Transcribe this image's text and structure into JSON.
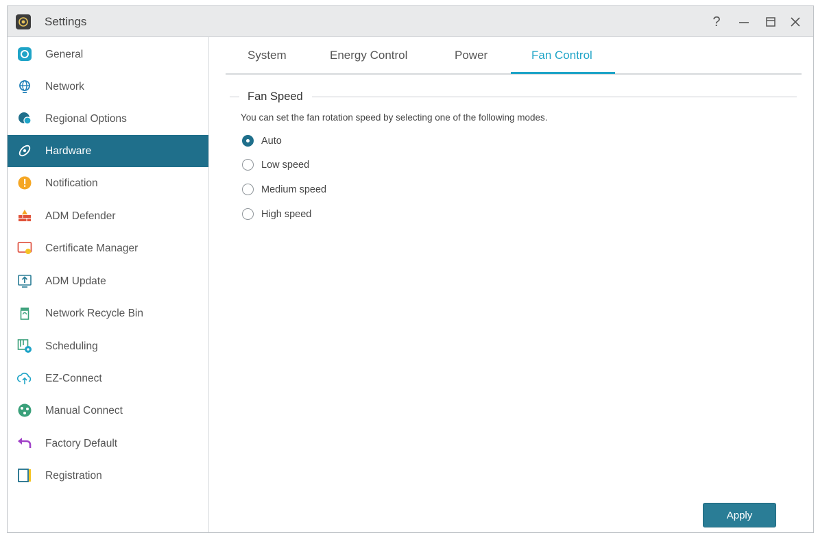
{
  "window": {
    "title": "Settings",
    "controls": [
      "help",
      "minimize",
      "maximize",
      "close"
    ]
  },
  "sidebar": {
    "selected": "Hardware",
    "items": [
      {
        "label": "General",
        "icon": "general-icon",
        "color": "#1fa4c7"
      },
      {
        "label": "Network",
        "icon": "globe-icon",
        "color": "#1f7fb8"
      },
      {
        "label": "Regional Options",
        "icon": "regional-icon",
        "color": "#1f6f8b"
      },
      {
        "label": "Hardware",
        "icon": "hardware-icon",
        "color": "#ffffff"
      },
      {
        "label": "Notification",
        "icon": "notification-icon",
        "color": "#f5a623"
      },
      {
        "label": "ADM Defender",
        "icon": "firewall-icon",
        "color": "#e0533a"
      },
      {
        "label": "Certificate Manager",
        "icon": "certificate-icon",
        "color": "#e05a4a"
      },
      {
        "label": "ADM Update",
        "icon": "update-icon",
        "color": "#2a7d96"
      },
      {
        "label": "Network Recycle Bin",
        "icon": "recycle-bin-icon",
        "color": "#3aa07a"
      },
      {
        "label": "Scheduling",
        "icon": "scheduling-icon",
        "color": "#3aa07a"
      },
      {
        "label": "EZ-Connect",
        "icon": "cloud-upload-icon",
        "color": "#1fa4c7"
      },
      {
        "label": "Manual Connect",
        "icon": "manual-connect-icon",
        "color": "#3aa07a"
      },
      {
        "label": "Factory Default",
        "icon": "undo-icon",
        "color": "#a142c8"
      },
      {
        "label": "Registration",
        "icon": "registration-icon",
        "color": "#1f6f8b"
      }
    ]
  },
  "tabs": {
    "active": "Fan Control",
    "items": [
      "System",
      "Energy Control",
      "Power",
      "Fan Control"
    ]
  },
  "fan_speed": {
    "section_title": "Fan Speed",
    "description": "You can set the fan rotation speed by selecting one of the following modes.",
    "selected": "Auto",
    "options": [
      "Auto",
      "Low speed",
      "Medium speed",
      "High speed"
    ]
  },
  "actions": {
    "apply_label": "Apply"
  },
  "colors": {
    "accent": "#1fa4c7",
    "sidebar_active": "#1f6f8b",
    "button": "#2a7d96"
  }
}
